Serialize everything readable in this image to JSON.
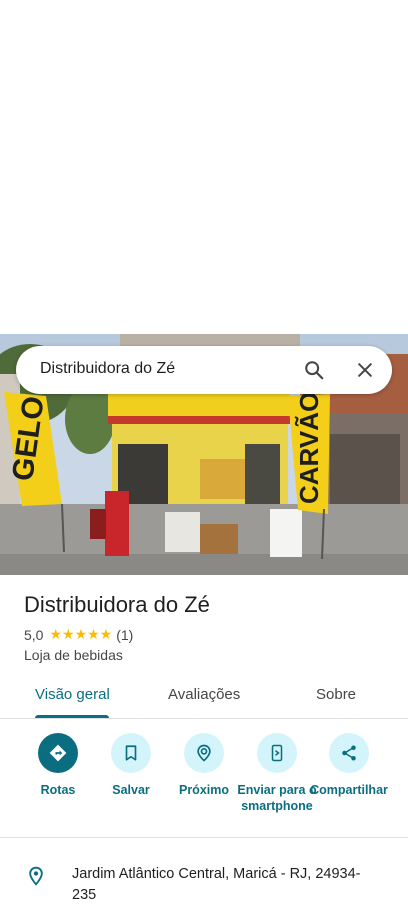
{
  "search": {
    "query": "Distribuidora do Zé"
  },
  "photo": {
    "banner_left": "GELO",
    "banner_right": "CARVÃO"
  },
  "place": {
    "name": "Distribuidora do Zé",
    "rating": "5,0",
    "stars": "★★★★★",
    "review_count": "(1)",
    "category": "Loja de bebidas"
  },
  "tabs": [
    {
      "label": "Visão geral"
    },
    {
      "label": "Avaliações"
    },
    {
      "label": "Sobre"
    }
  ],
  "actions": [
    {
      "label": "Rotas",
      "icon": "directions-icon"
    },
    {
      "label": "Salvar",
      "icon": "bookmark-icon"
    },
    {
      "label": "Próximo",
      "icon": "nearby-icon"
    },
    {
      "label": "Enviar para o smartphone",
      "icon": "send-to-phone-icon"
    },
    {
      "label": "Compartilhar",
      "icon": "share-icon"
    }
  ],
  "address": {
    "text": "Jardim Atlântico Central, Maricá - RJ, 24934-235"
  },
  "colors": {
    "accent": "#0b6e80",
    "action_bg": "#d3f4fb",
    "star": "#fbbc04"
  }
}
